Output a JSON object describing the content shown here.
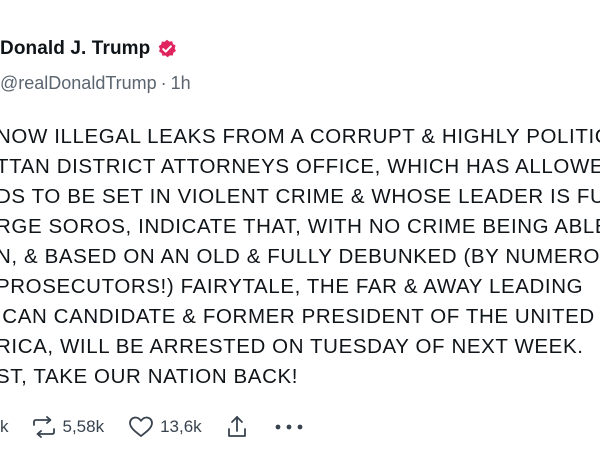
{
  "author": {
    "display_name": "Donald J. Trump",
    "handle": "@realDonaldTrump",
    "separator": "·",
    "time": "1h",
    "verified_color": "#e0245e"
  },
  "body": {
    "lines": [
      "NOW ILLEGAL LEAKS FROM A CORRUPT & HIGHLY POLITIC",
      "TTAN DISTRICT ATTORNEYS OFFICE, WHICH HAS ALLOWE",
      "DS TO BE SET IN VIOLENT CRIME & WHOSE LEADER IS FUN",
      "RGE SOROS, INDICATE THAT, WITH NO CRIME BEING ABLE",
      "N, & BASED ON AN OLD & FULLY DEBUNKED (BY NUMEROU",
      "PROSECUTORS!) FAIRYTALE, THE FAR & AWAY LEADING",
      "ICAN CANDIDATE & FORMER PRESIDENT OF THE UNITED",
      "RICA, WILL BE ARRESTED ON TUESDAY OF NEXT WEEK.",
      "ST, TAKE OUR NATION BACK!"
    ]
  },
  "actions": {
    "reply_count_fragment": "k",
    "repost_count": "5,58k",
    "like_count": "13,6k",
    "icons": [
      "reply-icon",
      "repost-icon",
      "like-icon",
      "share-icon",
      "more-icon"
    ]
  }
}
